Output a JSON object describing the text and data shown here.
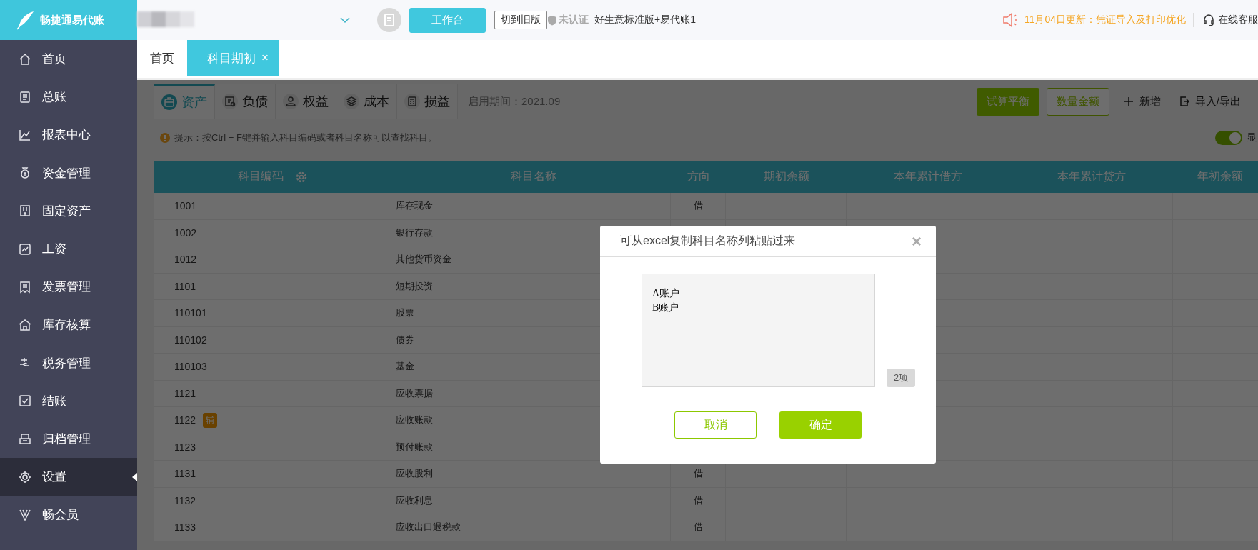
{
  "logo": {
    "text": "畅捷通易代账"
  },
  "sidebar": {
    "items": [
      {
        "label": "首页",
        "selected": false
      },
      {
        "label": "总账",
        "selected": false
      },
      {
        "label": "报表中心",
        "selected": false
      },
      {
        "label": "资金管理",
        "selected": false
      },
      {
        "label": "固定资产",
        "selected": false
      },
      {
        "label": "工资",
        "selected": false
      },
      {
        "label": "发票管理",
        "selected": false
      },
      {
        "label": "库存核算",
        "selected": false
      },
      {
        "label": "税务管理",
        "selected": false
      },
      {
        "label": "结账",
        "selected": false
      },
      {
        "label": "归档管理",
        "selected": false
      },
      {
        "label": "设置",
        "selected": true
      },
      {
        "label": "畅会员",
        "selected": false
      }
    ]
  },
  "top_bar": {
    "workbench_button": "工作台",
    "old_version_button": "切到旧版",
    "certification": "未认证",
    "edition": "好生意标准版+易代账1",
    "notice": "11月04日更新：凭证导入及打印优化",
    "support": "在线客服"
  },
  "page_tabs": [
    {
      "label": "首页",
      "selected": false
    },
    {
      "label": "科目期初",
      "selected": true,
      "close": "×"
    }
  ],
  "category_tabs": [
    {
      "label": "资产",
      "selected": true
    },
    {
      "label": "负债",
      "selected": false
    },
    {
      "label": "权益",
      "selected": false
    },
    {
      "label": "成本",
      "selected": false
    },
    {
      "label": "损益",
      "selected": false
    }
  ],
  "start_period": "启用期间：2021.09",
  "actions": [
    {
      "kind": "primary",
      "label": "试算平衡"
    },
    {
      "kind": "outline",
      "label": "数量金额"
    },
    {
      "kind": "link",
      "label": "新增"
    },
    {
      "kind": "link",
      "label": "导入/导出"
    }
  ],
  "tip": "提示：按Ctrl + F键并输入科目编码或者科目名称可以查找科目。",
  "display_toggle": {
    "on": true,
    "label": "显"
  },
  "table": {
    "columns": [
      "科目编码",
      "科目名称",
      "方向",
      "期初余额",
      "本年累计借方",
      "本年累计贷方",
      "年初余额"
    ],
    "rows": [
      {
        "code": "1001",
        "name": "库存现金",
        "direction": "借"
      },
      {
        "code": "1002",
        "name": "银行存款"
      },
      {
        "code": "1012",
        "name": "其他货币资金"
      },
      {
        "code": "1101",
        "name": "短期投资"
      },
      {
        "code": "110101",
        "name": "股票"
      },
      {
        "code": "110102",
        "name": "债券"
      },
      {
        "code": "110103",
        "name": "基金"
      },
      {
        "code": "1121",
        "name": "应收票据"
      },
      {
        "code": "1122",
        "badge": "辅",
        "name": "应收账款"
      },
      {
        "code": "1123",
        "name": "预付账款"
      },
      {
        "code": "1131",
        "name": "应收股利",
        "direction": "借"
      },
      {
        "code": "1132",
        "name": "应收利息",
        "direction": "借"
      },
      {
        "code": "1133",
        "name": "应收出口退税款",
        "direction": "借"
      }
    ]
  },
  "dialog": {
    "title": "可从excel复制科目名称列粘贴过来",
    "close": "×",
    "text": "A账户\nB账户",
    "count": "2项",
    "buttons": [
      {
        "kind": "cancel",
        "label": "取消"
      },
      {
        "kind": "confirm",
        "label": "确定"
      }
    ]
  }
}
